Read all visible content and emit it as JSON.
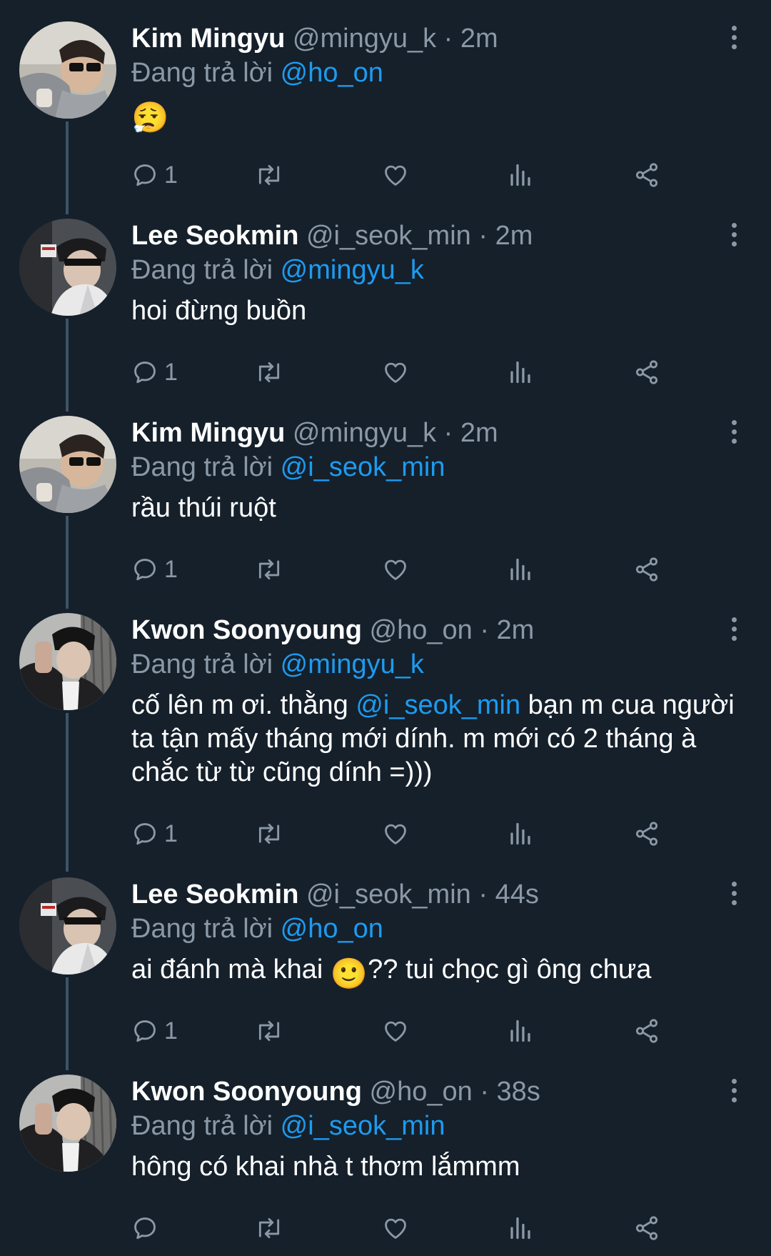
{
  "tweets": [
    {
      "name": "Kim Mingyu",
      "handle": "@mingyu_k",
      "separator": "·",
      "time": "2m",
      "reply_prefix": "Đang trả lời",
      "reply_to": "@ho_on",
      "text": "😮‍💨",
      "reply_count": "1",
      "avatar": "avatar-mingyu"
    },
    {
      "name": "Lee Seokmin",
      "handle": "@i_seok_min",
      "separator": "·",
      "time": "2m",
      "reply_prefix": "Đang trả lời",
      "reply_to": "@mingyu_k",
      "text": "hoi đừng buồn",
      "reply_count": "1",
      "avatar": "avatar-seokmin"
    },
    {
      "name": "Kim Mingyu",
      "handle": "@mingyu_k",
      "separator": "·",
      "time": "2m",
      "reply_prefix": "Đang trả lời",
      "reply_to": "@i_seok_min",
      "text": "rầu thúi ruột",
      "reply_count": "1",
      "avatar": "avatar-mingyu"
    },
    {
      "name": "Kwon Soonyoung",
      "handle": "@ho_on",
      "separator": "·",
      "time": "2m",
      "reply_prefix": "Đang trả lời",
      "reply_to": "@mingyu_k",
      "text_before": "cố lên m ơi. thằng ",
      "text_mention": "@i_seok_min",
      "text_after": " bạn m cua người ta tận mấy tháng mới dính. m mới có 2 tháng à chắc từ từ cũng dính =)))",
      "reply_count": "1",
      "avatar": "avatar-soonyoung"
    },
    {
      "name": "Lee Seokmin",
      "handle": "@i_seok_min",
      "separator": "·",
      "time": "44s",
      "reply_prefix": "Đang trả lời",
      "reply_to": "@ho_on",
      "text_before": "ai đánh mà khai ",
      "text_emoji": "🙂",
      "text_after": "?? tui chọc gì ông chưa",
      "reply_count": "1",
      "avatar": "avatar-seokmin"
    },
    {
      "name": "Kwon Soonyoung",
      "handle": "@ho_on",
      "separator": "·",
      "time": "38s",
      "reply_prefix": "Đang trả lời",
      "reply_to": "@i_seok_min",
      "text": "hông có khai nhà t thơm lắmmm",
      "reply_count": "",
      "avatar": "avatar-soonyoung"
    }
  ],
  "icons": {
    "reply": "reply-icon",
    "retweet": "retweet-icon",
    "like": "heart-icon",
    "views": "views-icon",
    "share": "share-icon",
    "more": "more-icon"
  },
  "colors": {
    "background": "#15202b",
    "primary_text": "#ffffff",
    "secondary_text": "#8b98a5",
    "link": "#1d9bf0",
    "thread_line": "#3d5466"
  }
}
